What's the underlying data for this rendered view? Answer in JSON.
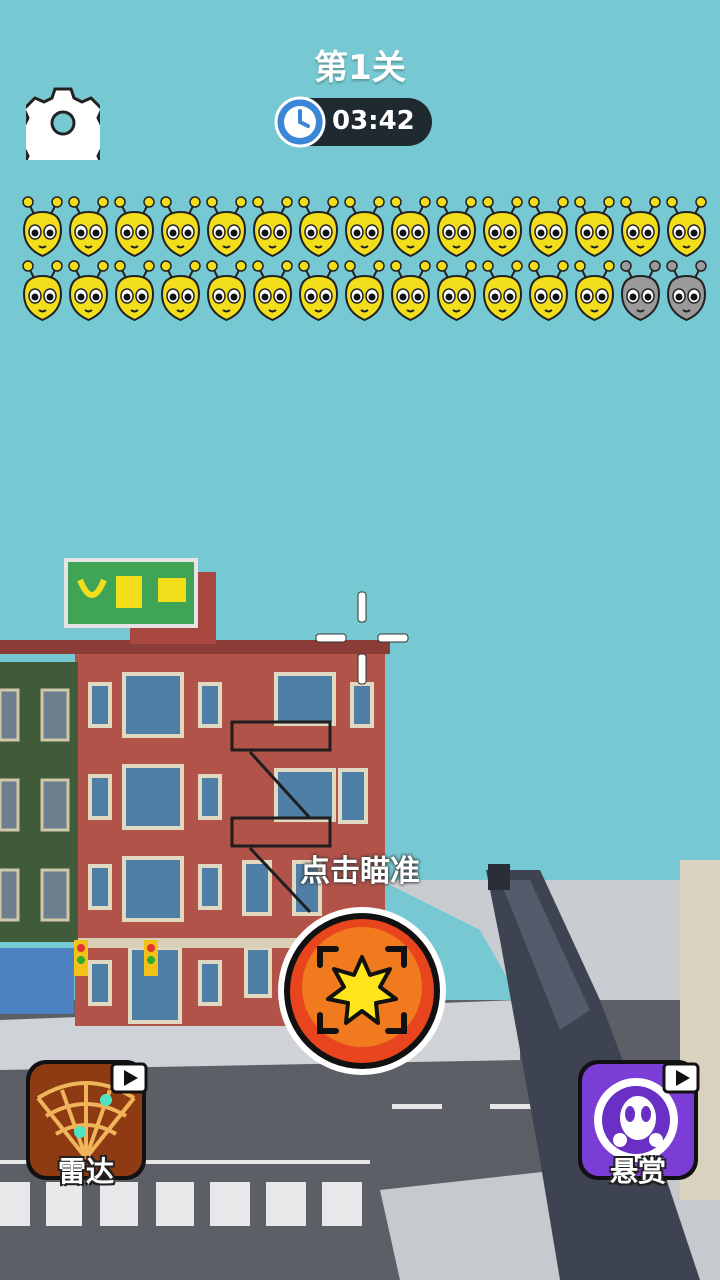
{
  "hud": {
    "level_title": "第1关",
    "timer": "03:42"
  },
  "targets": {
    "total": 30,
    "remaining": 28,
    "eliminated": 2,
    "active_color": "#f2de1b",
    "eliminated_color": "#9a9a9a"
  },
  "controls": {
    "aim_hint": "点击瞄准",
    "radar_label": "雷达",
    "bounty_label": "悬赏"
  },
  "colors": {
    "sky": "#76c9d2",
    "fire_button": "#e8451e",
    "building": "#b2534a",
    "street": "#5c5f66"
  },
  "icons": {
    "settings": "gear-icon",
    "timer": "clock-icon",
    "fire": "crosshair-burst-icon",
    "radar": "radar-icon",
    "bounty": "alien-skull-icon",
    "video_ad": "video-play-icon"
  }
}
